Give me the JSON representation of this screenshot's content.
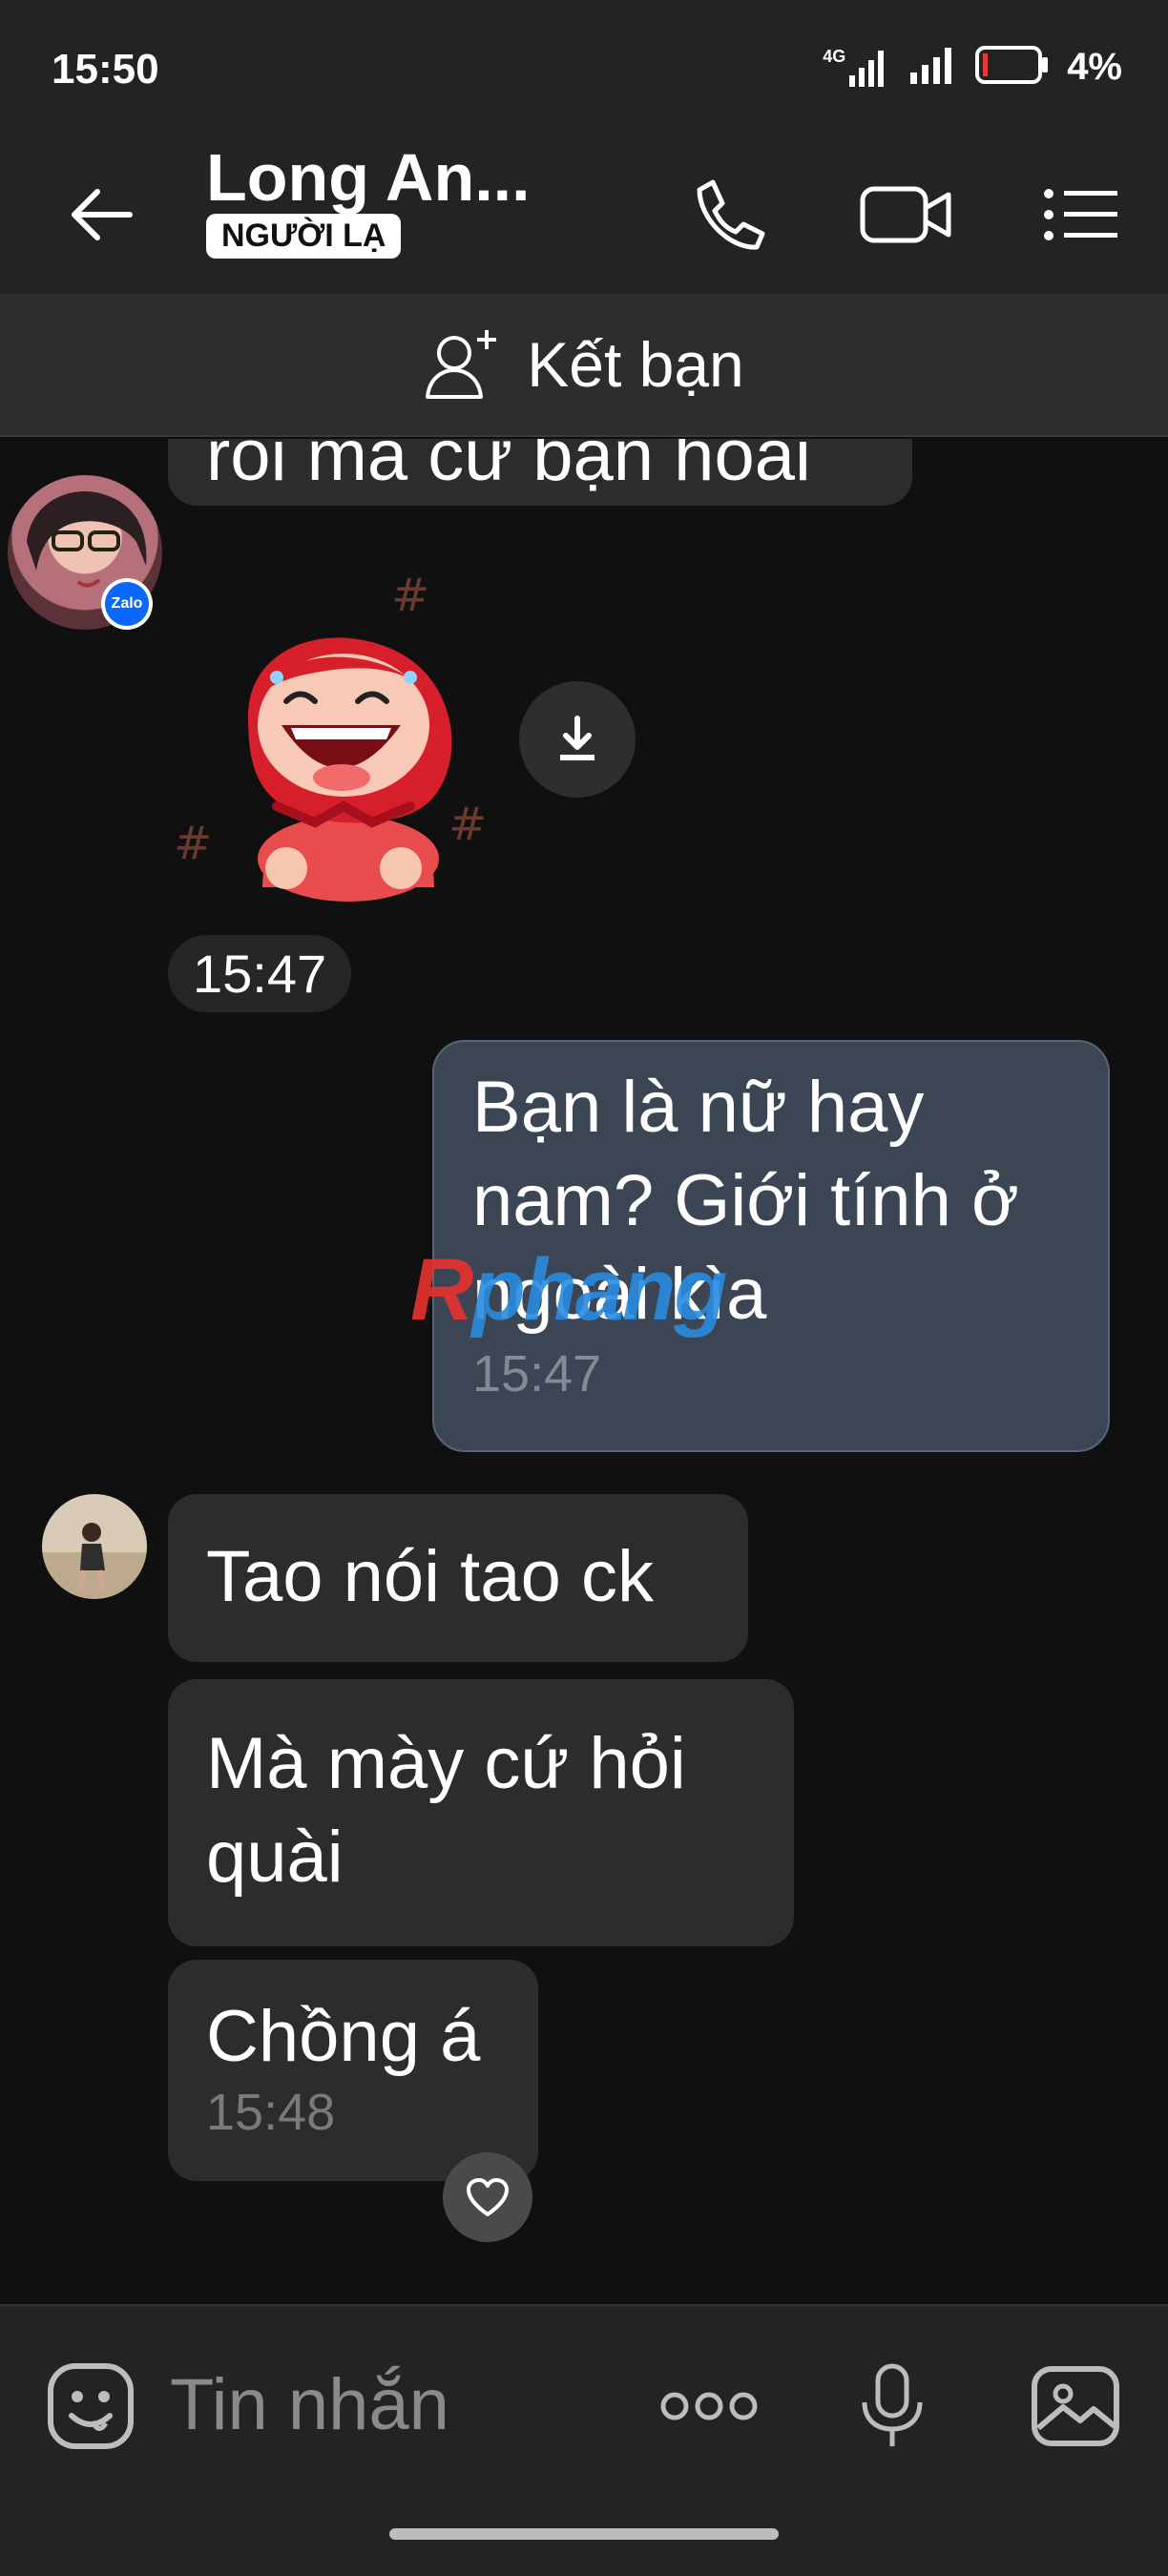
{
  "status_bar": {
    "time": "15:50",
    "network_label": "4G",
    "battery_percent": "4%"
  },
  "header": {
    "contact_name": "Long An...",
    "stranger_badge": "NGƯỜI LẠ",
    "icons": [
      "back-arrow-icon",
      "phone-icon",
      "video-call-icon",
      "menu-list-icon"
    ]
  },
  "friend_bar": {
    "label": "Kết bạn",
    "icon": "add-friend-icon"
  },
  "messages": [
    {
      "direction": "in",
      "text": "rồi mà cứ bạn hoài"
    },
    {
      "direction": "in",
      "type": "sticker",
      "time": "15:47"
    },
    {
      "direction": "out",
      "lines": [
        "Bạn là nữ hay",
        "nam? Giới tính ở",
        "ngoài kìa"
      ],
      "time": "15:47"
    },
    {
      "direction": "in",
      "text": "Tao nói tao ck"
    },
    {
      "direction": "in",
      "lines": [
        "Mà mày cứ hỏi",
        "quài"
      ]
    },
    {
      "direction": "in",
      "text": "Chồng á",
      "time": "15:48"
    }
  ],
  "avatar_badge": "Zalo",
  "watermark": {
    "part1": "R",
    "part2": "phang"
  },
  "input_bar": {
    "placeholder": "Tin nhắn",
    "icons": [
      "emoji-icon",
      "more-options-icon",
      "microphone-icon",
      "image-icon"
    ]
  },
  "colors": {
    "background": "#101010",
    "bar": "#232323",
    "incoming_bubble": "#2c2c2c",
    "outgoing_bubble": "#3b4553"
  }
}
